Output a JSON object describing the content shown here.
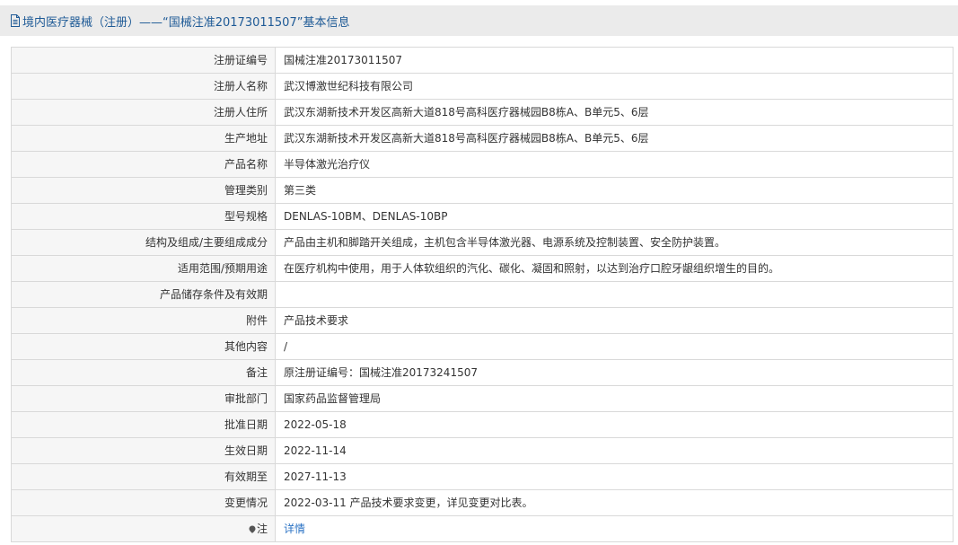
{
  "header": {
    "title": "境内医疗器械（注册）——“国械注准20173011507”基本信息",
    "icon": "document-icon"
  },
  "colors": {
    "header_bg": "#ebebeb",
    "header_text": "#1e5a96",
    "label_bg": "#f6f6f6",
    "border": "#d9d9d9",
    "link": "#2b73c4"
  },
  "rows": [
    {
      "label": "注册证编号",
      "value": "国械注准20173011507"
    },
    {
      "label": "注册人名称",
      "value": "武汉博激世纪科技有限公司"
    },
    {
      "label": "注册人住所",
      "value": "武汉东湖新技术开发区高新大道818号高科医疗器械园B8栋A、B单元5、6层"
    },
    {
      "label": "生产地址",
      "value": "武汉东湖新技术开发区高新大道818号高科医疗器械园B8栋A、B单元5、6层"
    },
    {
      "label": "产品名称",
      "value": "半导体激光治疗仪"
    },
    {
      "label": "管理类别",
      "value": "第三类"
    },
    {
      "label": "型号规格",
      "value": "DENLAS-10BM、DENLAS-10BP"
    },
    {
      "label": "结构及组成/主要组成成分",
      "value": "产品由主机和脚踏开关组成，主机包含半导体激光器、电源系统及控制装置、安全防护装置。"
    },
    {
      "label": "适用范围/预期用途",
      "value": "在医疗机构中使用，用于人体软组织的汽化、碳化、凝固和照射，以达到治疗口腔牙龈组织增生的目的。"
    },
    {
      "label": "产品储存条件及有效期",
      "value": ""
    },
    {
      "label": "附件",
      "value": "产品技术要求"
    },
    {
      "label": "其他内容",
      "value": "/"
    },
    {
      "label": "备注",
      "value": "原注册证编号：国械注准20173241507"
    },
    {
      "label": "审批部门",
      "value": "国家药品监督管理局"
    },
    {
      "label": "批准日期",
      "value": "2022-05-18"
    },
    {
      "label": "生效日期",
      "value": "2022-11-14"
    },
    {
      "label": "有效期至",
      "value": "2027-11-13"
    },
    {
      "label": "变更情况",
      "value": "2022-03-11 产品技术要求变更，详见变更对比表。"
    }
  ],
  "note_row": {
    "label": "注",
    "icon": "location-pin-icon",
    "link_text": "详情"
  }
}
